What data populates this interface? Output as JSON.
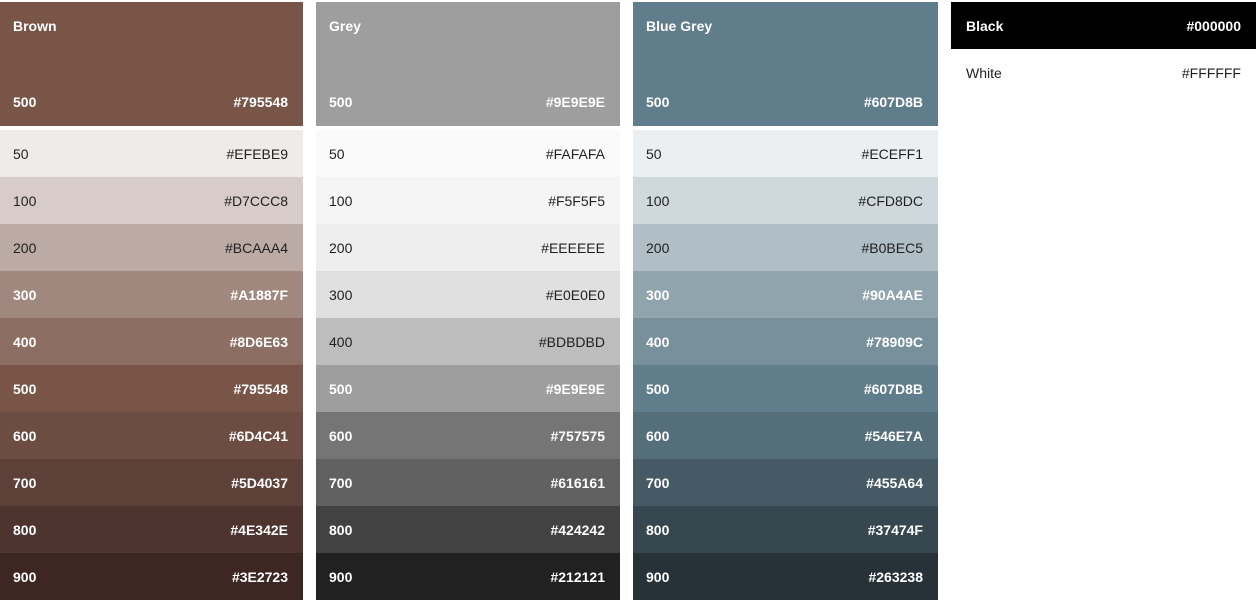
{
  "palettes": [
    {
      "name": "Brown",
      "primary": {
        "shade": "500",
        "hex": "#795548"
      },
      "shades": [
        {
          "shade": "50",
          "hex": "#EFEBE9",
          "dark": false
        },
        {
          "shade": "100",
          "hex": "#D7CCC8",
          "dark": false
        },
        {
          "shade": "200",
          "hex": "#BCAAA4",
          "dark": false
        },
        {
          "shade": "300",
          "hex": "#A1887F",
          "dark": true
        },
        {
          "shade": "400",
          "hex": "#8D6E63",
          "dark": true
        },
        {
          "shade": "500",
          "hex": "#795548",
          "dark": true
        },
        {
          "shade": "600",
          "hex": "#6D4C41",
          "dark": true
        },
        {
          "shade": "700",
          "hex": "#5D4037",
          "dark": true
        },
        {
          "shade": "800",
          "hex": "#4E342E",
          "dark": true
        },
        {
          "shade": "900",
          "hex": "#3E2723",
          "dark": true
        }
      ]
    },
    {
      "name": "Grey",
      "primary": {
        "shade": "500",
        "hex": "#9E9E9E"
      },
      "shades": [
        {
          "shade": "50",
          "hex": "#FAFAFA",
          "dark": false
        },
        {
          "shade": "100",
          "hex": "#F5F5F5",
          "dark": false
        },
        {
          "shade": "200",
          "hex": "#EEEEEE",
          "dark": false
        },
        {
          "shade": "300",
          "hex": "#E0E0E0",
          "dark": false
        },
        {
          "shade": "400",
          "hex": "#BDBDBD",
          "dark": false
        },
        {
          "shade": "500",
          "hex": "#9E9E9E",
          "dark": true
        },
        {
          "shade": "600",
          "hex": "#757575",
          "dark": true
        },
        {
          "shade": "700",
          "hex": "#616161",
          "dark": true
        },
        {
          "shade": "800",
          "hex": "#424242",
          "dark": true
        },
        {
          "shade": "900",
          "hex": "#212121",
          "dark": true
        }
      ]
    },
    {
      "name": "Blue Grey",
      "primary": {
        "shade": "500",
        "hex": "#607D8B"
      },
      "shades": [
        {
          "shade": "50",
          "hex": "#ECEFF1",
          "dark": false
        },
        {
          "shade": "100",
          "hex": "#CFD8DC",
          "dark": false
        },
        {
          "shade": "200",
          "hex": "#B0BEC5",
          "dark": false
        },
        {
          "shade": "300",
          "hex": "#90A4AE",
          "dark": true
        },
        {
          "shade": "400",
          "hex": "#78909C",
          "dark": true
        },
        {
          "shade": "500",
          "hex": "#607D8B",
          "dark": true
        },
        {
          "shade": "600",
          "hex": "#546E7A",
          "dark": true
        },
        {
          "shade": "700",
          "hex": "#455A64",
          "dark": true
        },
        {
          "shade": "800",
          "hex": "#37474F",
          "dark": true
        },
        {
          "shade": "900",
          "hex": "#263238",
          "dark": true
        }
      ]
    }
  ],
  "black_white": [
    {
      "name": "Black",
      "hex": "#000000"
    },
    {
      "name": "White",
      "hex": "#FFFFFF"
    }
  ]
}
